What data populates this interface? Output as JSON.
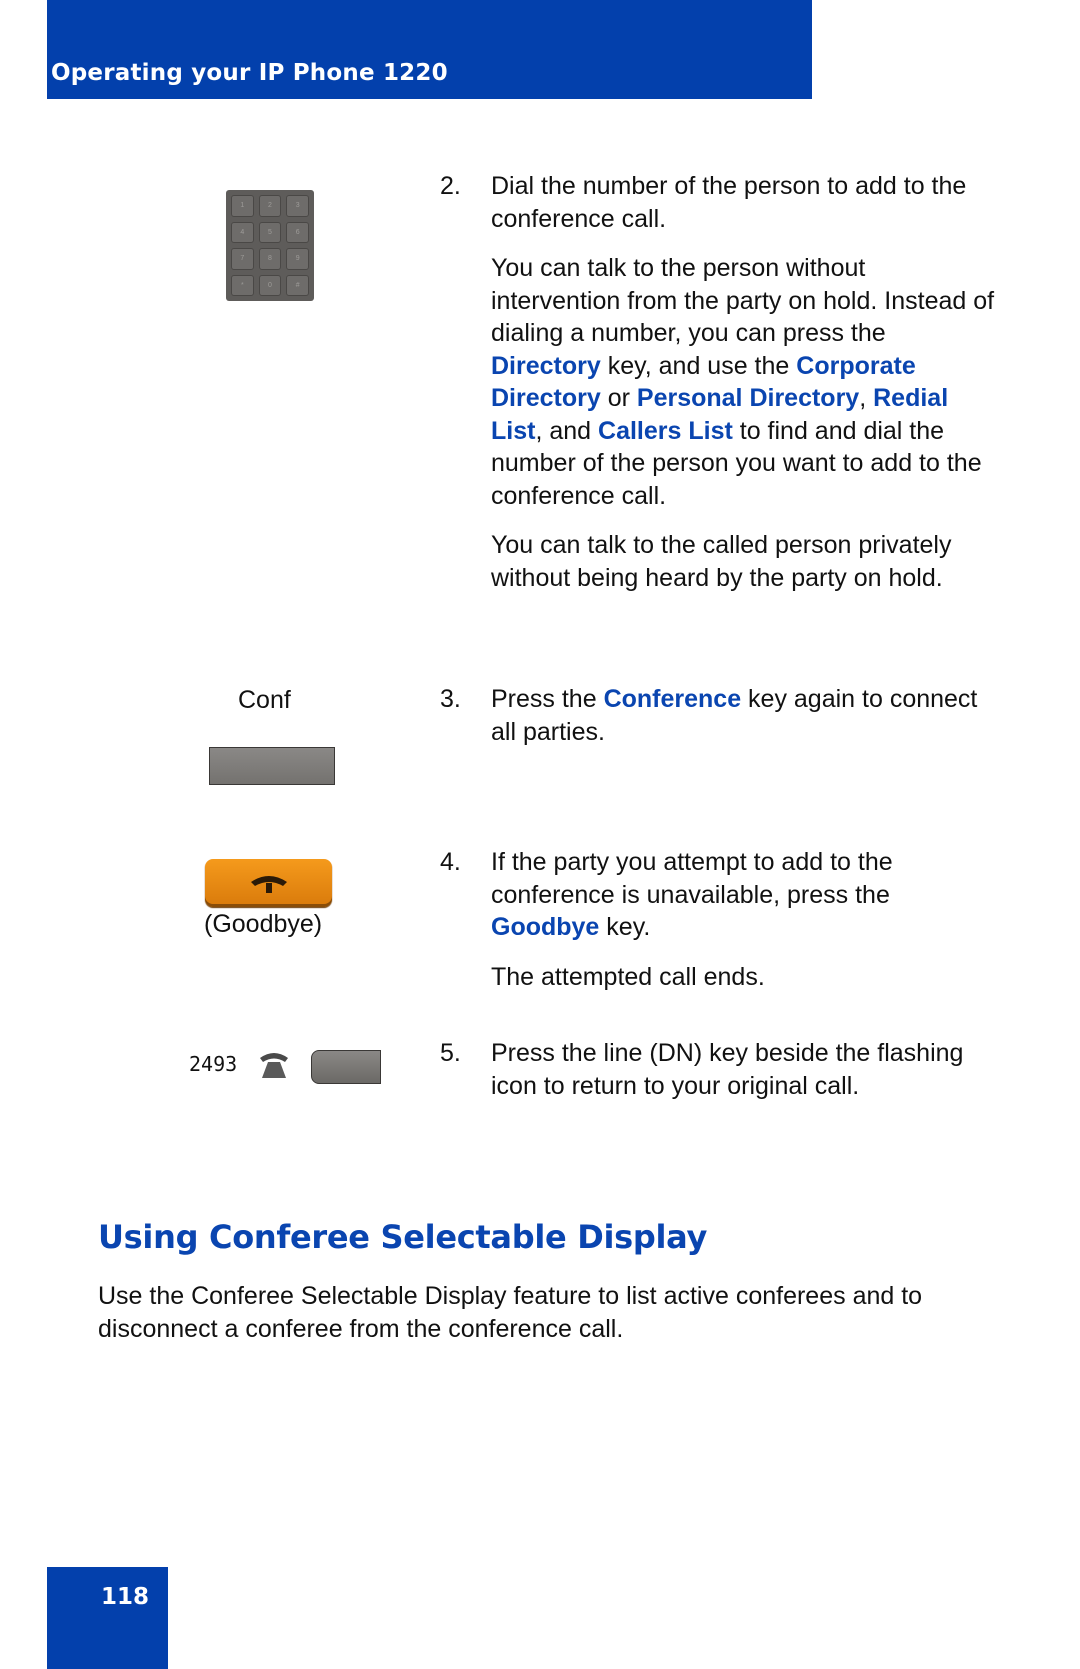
{
  "header": {
    "title": "Operating your IP Phone 1220"
  },
  "colors": {
    "brand_blue": "#0340ac",
    "keyword_blue": "#0a45b0",
    "goodbye_orange": "#f59a1c"
  },
  "keypad": {
    "keys": [
      "1",
      "2",
      "3",
      "4",
      "5",
      "6",
      "7",
      "8",
      "9",
      "*",
      "0",
      "#"
    ]
  },
  "steps": [
    {
      "number": "2.",
      "paragraphs": [
        {
          "segments": [
            {
              "t": "Dial the number of the person to add to the conference call."
            }
          ]
        },
        {
          "segments": [
            {
              "t": "You can talk to the person without intervention from the party on hold. Instead of dialing a number, you can press the "
            },
            {
              "t": "Directory",
              "kw": true
            },
            {
              "t": " key, and use the "
            },
            {
              "t": "Corporate Directory",
              "kw": true
            },
            {
              "t": " or "
            },
            {
              "t": "Personal Directory",
              "kw": true
            },
            {
              "t": ", "
            },
            {
              "t": "Redial List",
              "kw": true
            },
            {
              "t": ", and "
            },
            {
              "t": "Callers List",
              "kw": true
            },
            {
              "t": " to find and dial the number of the person you want to add to the conference call."
            }
          ]
        },
        {
          "segments": [
            {
              "t": "You can talk to the called person privately without being heard by the party on hold."
            }
          ]
        }
      ]
    },
    {
      "number": "3.",
      "paragraphs": [
        {
          "segments": [
            {
              "t": "Press the "
            },
            {
              "t": "Conference",
              "kw": true
            },
            {
              "t": " key again to connect all parties."
            }
          ]
        }
      ]
    },
    {
      "number": "4.",
      "paragraphs": [
        {
          "segments": [
            {
              "t": "If the party you attempt to add to the conference is unavailable, press the "
            },
            {
              "t": "Goodbye",
              "kw": true
            },
            {
              "t": " key."
            }
          ]
        },
        {
          "segments": [
            {
              "t": "The attempted call ends."
            }
          ]
        }
      ]
    },
    {
      "number": "5.",
      "paragraphs": [
        {
          "segments": [
            {
              "t": "Press the line (DN) key beside the flashing icon to return to your original call."
            }
          ]
        }
      ]
    }
  ],
  "figures": {
    "conf_label": "Conf",
    "goodbye_label": "(Goodbye)",
    "dn_number": "2493"
  },
  "section": {
    "heading": "Using Conferee Selectable Display",
    "body": "Use the Conferee Selectable Display feature to list active conferees and to disconnect a conferee from the conference call."
  },
  "footer": {
    "page_number": "118"
  }
}
